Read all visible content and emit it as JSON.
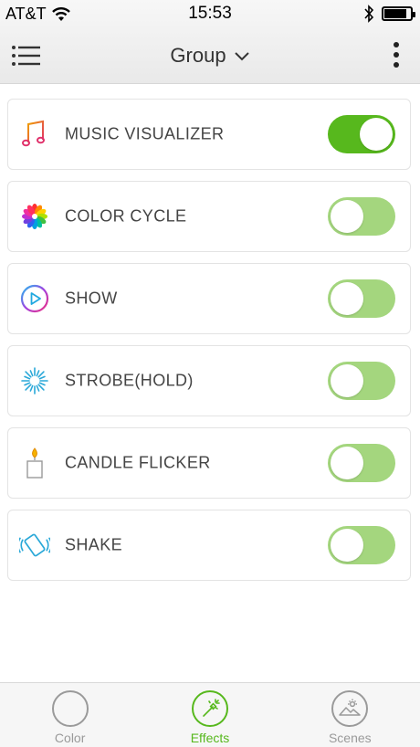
{
  "status_bar": {
    "carrier": "AT&T",
    "time": "15:53"
  },
  "nav": {
    "title": "Group"
  },
  "effects": [
    {
      "label": "MUSIC VISUALIZER",
      "icon": "music-notes-icon",
      "enabled": true
    },
    {
      "label": "COLOR CYCLE",
      "icon": "color-wheel-icon",
      "enabled": false
    },
    {
      "label": "SHOW",
      "icon": "play-circle-icon",
      "enabled": false
    },
    {
      "label": "STROBE(HOLD)",
      "icon": "strobe-burst-icon",
      "enabled": false
    },
    {
      "label": "CANDLE FLICKER",
      "icon": "candle-icon",
      "enabled": false
    },
    {
      "label": "SHAKE",
      "icon": "shake-phone-icon",
      "enabled": false
    }
  ],
  "tabs": [
    {
      "label": "Color",
      "icon": "color-circle-icon",
      "active": false
    },
    {
      "label": "Effects",
      "icon": "magic-wand-icon",
      "active": true
    },
    {
      "label": "Scenes",
      "icon": "scenes-landscape-icon",
      "active": false
    }
  ],
  "colors": {
    "accent": "#57b81d",
    "toggle_off": "#a4d67e",
    "inactive_tab": "#9a9a9a"
  }
}
